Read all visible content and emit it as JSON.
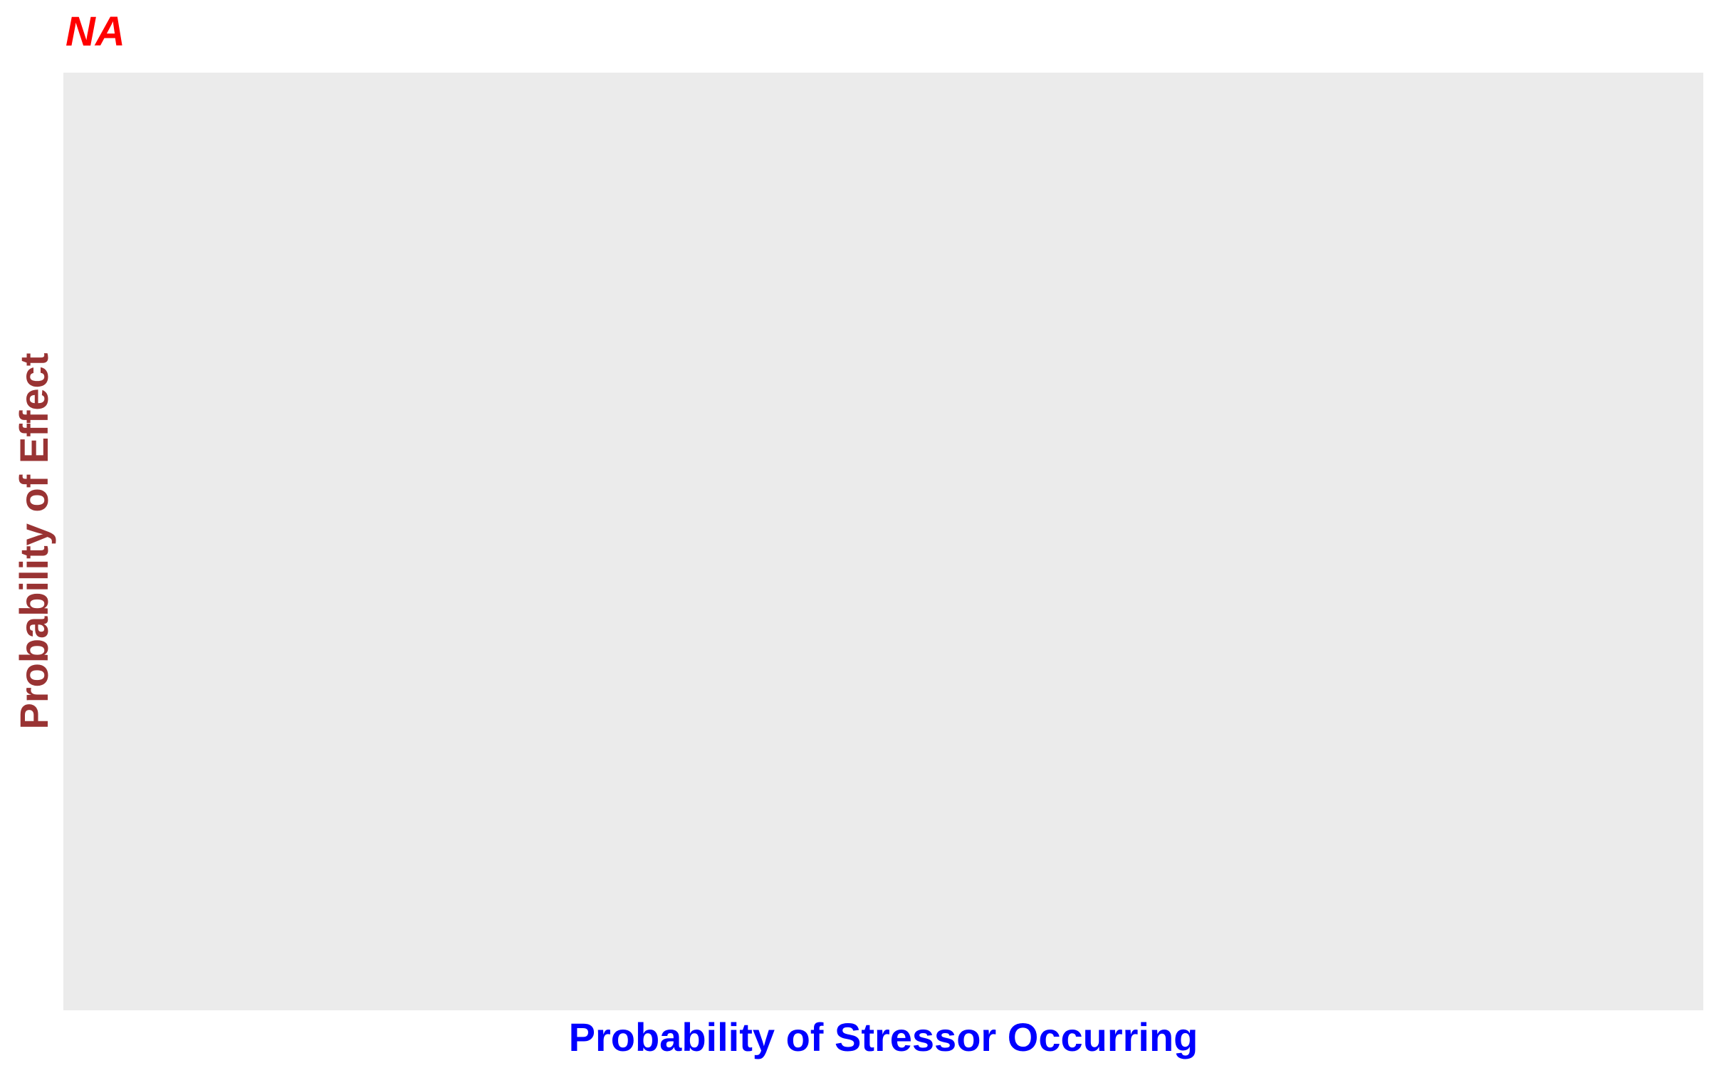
{
  "chart_data": {
    "type": "scatter",
    "title": "NA",
    "xlabel": "Probability of Stressor Occurring",
    "ylabel": "Probability of Effect",
    "series": [],
    "grid": false,
    "legend": "none"
  },
  "colors": {
    "title": "#FF0000",
    "xlabel": "#0000FF",
    "ylabel": "#993333",
    "panel_background": "#EBEBEB",
    "page_background": "#FFFFFF"
  }
}
